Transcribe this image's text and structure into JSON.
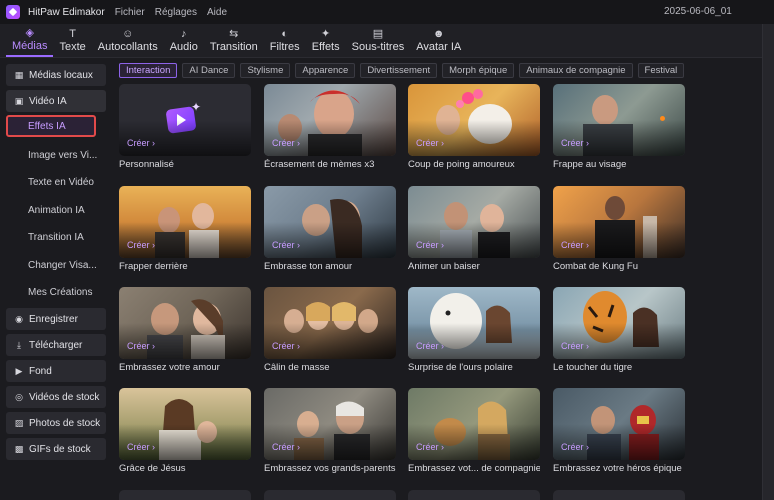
{
  "titlebar": {
    "app_title": "HitPaw Edimakor",
    "menu": [
      "Fichier",
      "Réglages",
      "Aide"
    ],
    "project_name": "2025-06-06_01"
  },
  "toolbar": {
    "tabs": [
      {
        "label": "Médias",
        "icon": "media-icon"
      },
      {
        "label": "Texte",
        "icon": "text-icon"
      },
      {
        "label": "Autocollants",
        "icon": "sticker-icon"
      },
      {
        "label": "Audio",
        "icon": "audio-icon"
      },
      {
        "label": "Transition",
        "icon": "transition-icon"
      },
      {
        "label": "Filtres",
        "icon": "filter-icon"
      },
      {
        "label": "Effets",
        "icon": "effects-icon"
      },
      {
        "label": "Sous-titres",
        "icon": "subtitles-icon"
      },
      {
        "label": "Avatar IA",
        "icon": "avatar-icon"
      }
    ]
  },
  "sidebar": {
    "items": [
      {
        "label": "Médias locaux",
        "icon": "folder-icon"
      },
      {
        "label": "Vidéo IA",
        "icon": "ai-video-icon"
      },
      {
        "label": "Effets IA"
      },
      {
        "label": "Image vers Vi..."
      },
      {
        "label": "Texte en Vidéo"
      },
      {
        "label": "Animation IA"
      },
      {
        "label": "Transition IA"
      },
      {
        "label": "Changer Visa..."
      },
      {
        "label": "Mes Créations"
      },
      {
        "label": "Enregistrer",
        "icon": "record-icon"
      },
      {
        "label": "Télécharger",
        "icon": "download-icon"
      },
      {
        "label": "Fond",
        "icon": "background-icon"
      },
      {
        "label": "Vidéos de stock",
        "icon": "stock-video-icon"
      },
      {
        "label": "Photos de stock",
        "icon": "stock-photo-icon"
      },
      {
        "label": "GIFs de stock",
        "icon": "gif-icon"
      }
    ]
  },
  "filters": [
    "Interaction",
    "AI Dance",
    "Stylisme",
    "Apparence",
    "Divertissement",
    "Morph épique",
    "Animaux de compagnie",
    "Festival"
  ],
  "create_label": "Créer  ›",
  "cards": [
    {
      "caption": "Personnalisé"
    },
    {
      "caption": "Écrasement de mèmes x3"
    },
    {
      "caption": "Coup de poing amoureux"
    },
    {
      "caption": "Frappe au visage"
    },
    {
      "caption": "Frapper derrière"
    },
    {
      "caption": "Embrasse ton amour"
    },
    {
      "caption": "Animer un baiser"
    },
    {
      "caption": "Combat de Kung Fu"
    },
    {
      "caption": "Embrassez votre amour"
    },
    {
      "caption": "Câlin de masse"
    },
    {
      "caption": "Surprise de l'ours polaire"
    },
    {
      "caption": "Le toucher du tigre"
    },
    {
      "caption": "Grâce de Jésus"
    },
    {
      "caption": "Embrassez vos grands-parents"
    },
    {
      "caption": "Embrassez vot... de compagnie"
    },
    {
      "caption": "Embrassez votre héros épique"
    }
  ],
  "colors": {
    "accent": "#9b6bff",
    "selection_outline": "#e24a4a",
    "background": "#1b1b1f"
  }
}
